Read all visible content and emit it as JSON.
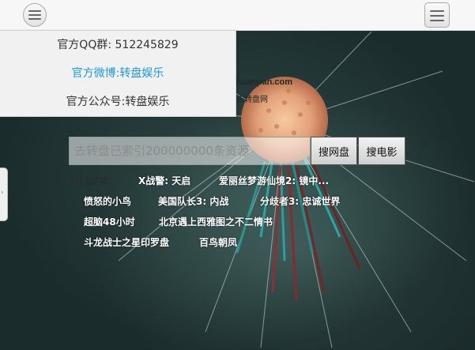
{
  "header": {
    "left_menu_icon": "hamburger-icon",
    "right_menu_icon": "hamburger-icon"
  },
  "dropdown": {
    "items": [
      {
        "label": "官方QQ群: 512245829"
      },
      {
        "label": "官方微博:转盘娱乐"
      },
      {
        "label": "官方公众号:转盘娱乐"
      }
    ],
    "link_color": "#1a9ae0"
  },
  "logo": {
    "domain": "zhuanpan.com",
    "tagline": "去转盘网"
  },
  "search": {
    "placeholder": "去转盘已索引200000000条资源",
    "value": "",
    "btn_netdisk": "搜网盘",
    "btn_movie": "搜电影"
  },
  "hot": {
    "label": "热门搜索:",
    "items": [
      {
        "text": "X战警: 天启"
      },
      {
        "text": "爱丽丝梦游仙境2: 镜中..."
      },
      {
        "text": "愤怒的小鸟"
      },
      {
        "text": "美国队长3: 内战"
      },
      {
        "text": "分歧者3: 忠诚世界"
      },
      {
        "text": "超脑48小时"
      },
      {
        "text": "北京遇上西雅图之不二情书"
      },
      {
        "text": "斗龙战士之星印罗盘"
      },
      {
        "text": "百鸟朝凤"
      }
    ]
  },
  "side_tab": {
    "icon": "chevron-right-icon",
    "glyph": "›"
  }
}
